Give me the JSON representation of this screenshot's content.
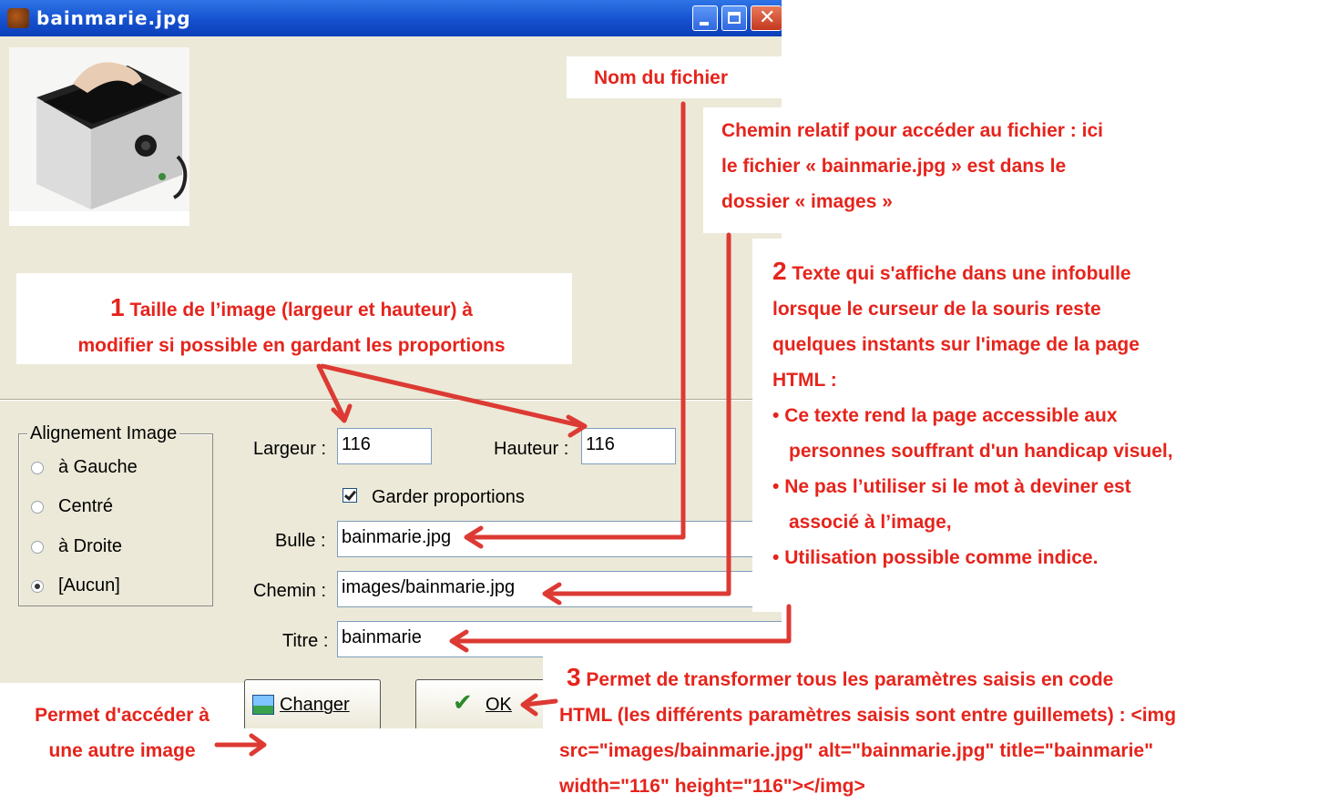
{
  "window": {
    "title": "bainmarie.jpg",
    "controls": [
      "minimize-icon",
      "maximize-icon",
      "close-icon"
    ]
  },
  "alignment": {
    "title": "Alignement Image",
    "options": [
      "à Gauche",
      "Centré",
      "à Droite",
      "[Aucun]"
    ],
    "selected": "[Aucun]"
  },
  "size": {
    "width_label": "Largeur :",
    "width_value": "116",
    "height_label": "Hauteur :",
    "height_value": "116",
    "keep_proportions_label": "Garder proportions",
    "keep_proportions_checked": true
  },
  "fields": {
    "bulle_label": "Bulle :",
    "bulle_value": "bainmarie.jpg",
    "chemin_label": "Chemin :",
    "chemin_value": "images/bainmarie.jpg",
    "titre_label": "Titre :",
    "titre_value": "bainmarie"
  },
  "buttons": {
    "change_label": "Changer",
    "ok_label": "OK"
  },
  "annotations": {
    "nom_fichier": "Nom du fichier",
    "chemin": [
      "Chemin relatif pour accéder au fichier : ici",
      "le fichier « bainmarie.jpg » est dans le",
      "dossier « images »"
    ],
    "taille_num": "1",
    "taille": [
      "Taille de l’image (largeur et hauteur) à",
      "modifier si possible en gardant les proportions"
    ],
    "infobulle_num": "2",
    "infobulle": [
      "Texte qui s'affiche dans une infobulle",
      "lorsque le curseur de la souris reste",
      "quelques instants sur l'image de la page",
      "HTML :"
    ],
    "infobulle_bullets": [
      "Ce texte rend  la page accessible aux",
      "personnes souffrant d'un handicap visuel,",
      "Ne pas l’utiliser si le mot à deviner  est",
      "associé à l’image,",
      "Utilisation possible comme indice."
    ],
    "transform_num": "3",
    "transform": [
      "Permet de transformer tous les paramètres saisis en code",
      "HTML (les différents paramètres saisis sont  entre guillemets) : <img",
      "src=\"images/bainmarie.jpg\" alt=\"bainmarie.jpg\" title=\"bainmarie\"",
      "width=\"116\" height=\"116\"></img>"
    ],
    "autre_image": [
      "Permet d'accéder à",
      "une autre image"
    ]
  },
  "colors": {
    "annotation_red": "#e5241c",
    "arrow_red": "#dc3a33",
    "titlebar_blue": "#1551cf",
    "dialog_bg": "#ece9d8"
  }
}
